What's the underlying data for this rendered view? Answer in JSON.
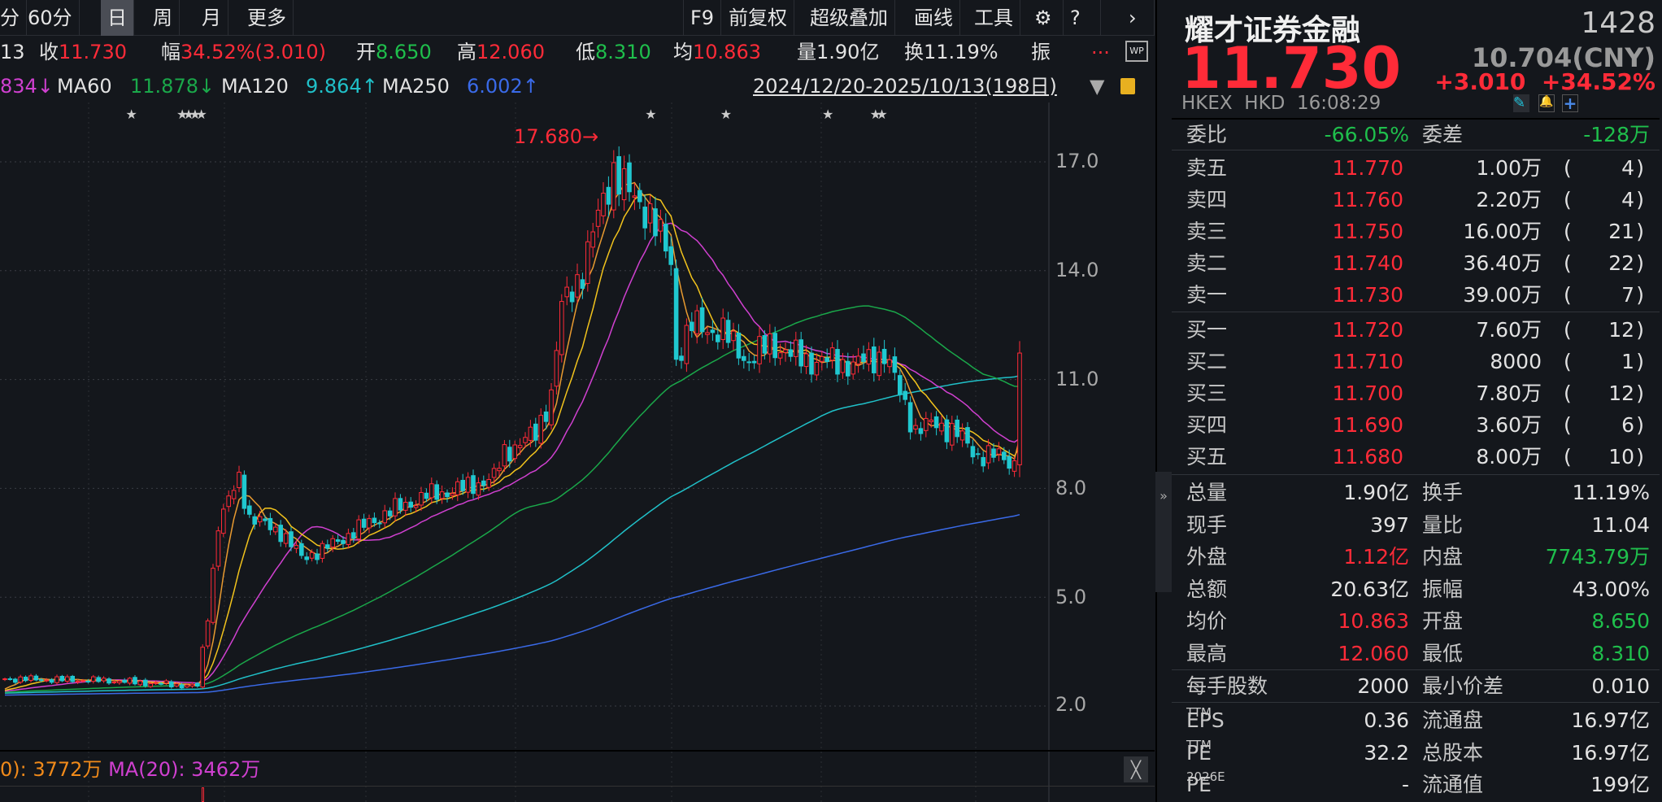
{
  "toolbar": {
    "cut_left": "分",
    "periods": [
      "60分",
      "日",
      "周",
      "月",
      "更多"
    ],
    "active_period": "日",
    "right": [
      "F9",
      "前复权",
      "超级叠加",
      "画线",
      "工具"
    ],
    "icons": [
      "gear-icon",
      "help-icon",
      "chevron-right-icon"
    ]
  },
  "info": {
    "cut_left": "13",
    "close_label": "收",
    "close": "11.730",
    "change_label": "幅",
    "change": "34.52%(3.010)",
    "open_label": "开",
    "open": "8.650",
    "high_label": "高",
    "high": "12.060",
    "low_label": "低",
    "low": "8.310",
    "avg_label": "均",
    "avg": "10.863",
    "vol_label": "量",
    "vol": "1.90亿",
    "turnover_label": "换",
    "turnover": "11.19%",
    "amp_label": "振",
    "more": "...",
    "wp": "WP"
  },
  "ma_row": {
    "ma20_cut": "834↓",
    "ma60_label": "MA60",
    "ma60": "11.878↓",
    "ma120_label": "MA120",
    "ma120": "9.864↑",
    "ma250_label": "MA250",
    "ma250": "6.002↑",
    "date_range": "2024/12/20-2025/10/13(198日)"
  },
  "chart_data": {
    "type": "candlestick",
    "y_ticks": [
      "17.0",
      "14.0",
      "11.0",
      "8.0",
      "5.0",
      "2.0"
    ],
    "ylim": [
      1.0,
      18.5
    ],
    "peak_label": "17.680",
    "close_keypoints": [
      [
        0,
        2.75
      ],
      [
        20,
        2.7
      ],
      [
        37,
        2.55
      ],
      [
        39,
        4.5
      ],
      [
        41,
        7
      ],
      [
        45,
        8.3
      ],
      [
        47,
        7.2
      ],
      [
        53,
        6.8
      ],
      [
        57,
        6.1
      ],
      [
        61,
        6.3
      ],
      [
        67,
        6.8
      ],
      [
        73,
        7.3
      ],
      [
        81,
        7.8
      ],
      [
        88,
        8.0
      ],
      [
        94,
        8.3
      ],
      [
        96,
        9.0
      ],
      [
        102,
        9.5
      ],
      [
        105,
        10.6
      ],
      [
        107,
        13.0
      ],
      [
        111,
        14.0
      ],
      [
        114,
        15.5
      ],
      [
        117,
        16.8
      ],
      [
        120,
        16.1
      ],
      [
        124,
        15.6
      ],
      [
        128,
        14.2
      ],
      [
        129,
        11.6
      ],
      [
        132,
        12.5
      ],
      [
        138,
        12.3
      ],
      [
        143,
        11.5
      ],
      [
        147,
        12.0
      ],
      [
        151,
        11.7
      ],
      [
        155,
        11.5
      ],
      [
        159,
        11.5
      ],
      [
        163,
        11.4
      ],
      [
        169,
        11.7
      ],
      [
        171,
        11.0
      ],
      [
        175,
        9.6
      ],
      [
        179,
        9.8
      ],
      [
        183,
        9.5
      ],
      [
        187,
        8.9
      ],
      [
        191,
        8.9
      ],
      [
        194,
        8.7
      ]
    ],
    "last_candle": {
      "open": 8.65,
      "high": 12.06,
      "low": 8.31,
      "close": 11.73
    },
    "colors": {
      "up": "#ff2b38",
      "down": "#20c8d0",
      "ma5": "#e8e8e8",
      "ma10": "#f2c31c",
      "ma20": "#d040d0",
      "ma60": "#1aa84a",
      "ma120": "#20c0c8",
      "ma250": "#3a6ae8"
    }
  },
  "volume": {
    "ma_cut": "0): 3772万",
    "ma20": "MA(20): 3462万"
  },
  "quote": {
    "name": "耀才证券金融",
    "code": "1428",
    "price": "11.730",
    "cny": "10.704(CNY)",
    "change": "+3.010",
    "change_pct": "+34.52%",
    "exchange": "HKEX",
    "currency": "HKD",
    "time": "16:08:29",
    "wei_bi_label": "委比",
    "wei_bi": "-66.05%",
    "wei_cha_label": "委差",
    "wei_cha": "-128万",
    "asks": [
      {
        "label": "卖五",
        "price": "11.770",
        "vol": "1.00万",
        "n": "4"
      },
      {
        "label": "卖四",
        "price": "11.760",
        "vol": "2.20万",
        "n": "4"
      },
      {
        "label": "卖三",
        "price": "11.750",
        "vol": "16.00万",
        "n": "21"
      },
      {
        "label": "卖二",
        "price": "11.740",
        "vol": "36.40万",
        "n": "22"
      },
      {
        "label": "卖一",
        "price": "11.730",
        "vol": "39.00万",
        "n": "7"
      }
    ],
    "bids": [
      {
        "label": "买一",
        "price": "11.720",
        "vol": "7.60万",
        "n": "12"
      },
      {
        "label": "买二",
        "price": "11.710",
        "vol": "8000",
        "n": "1"
      },
      {
        "label": "买三",
        "price": "11.700",
        "vol": "7.80万",
        "n": "12"
      },
      {
        "label": "买四",
        "price": "11.690",
        "vol": "3.60万",
        "n": "6"
      },
      {
        "label": "买五",
        "price": "11.680",
        "vol": "8.00万",
        "n": "10"
      }
    ],
    "stats": [
      [
        "总量",
        "1.90亿",
        "",
        "换手",
        "11.19%",
        ""
      ],
      [
        "现手",
        "397",
        "",
        "量比",
        "11.04",
        ""
      ],
      [
        "外盘",
        "1.12亿",
        "red",
        "内盘",
        "7743.79万",
        "green"
      ],
      [
        "总额",
        "20.63亿",
        "",
        "振幅",
        "43.00%",
        ""
      ],
      [
        "均价",
        "10.863",
        "red",
        "开盘",
        "8.650",
        "green"
      ],
      [
        "最高",
        "12.060",
        "red",
        "最低",
        "8.310",
        "green"
      ],
      [
        "每手股数",
        "2000",
        "",
        "最小价差",
        "0.010",
        ""
      ]
    ],
    "fund": [
      [
        "EPS",
        "TTM",
        "0.36",
        "流通盘",
        "16.97亿"
      ],
      [
        "PE",
        "TTM",
        "32.2",
        "总股本",
        "16.97亿"
      ],
      [
        "PE",
        "2026E",
        "-",
        "流通值",
        "199亿"
      ]
    ]
  }
}
